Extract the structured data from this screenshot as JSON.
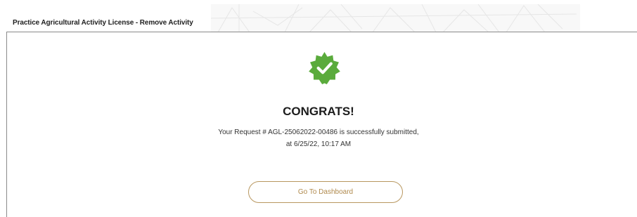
{
  "header": {
    "title": "Practice Agricultural Activity License - Remove Activity"
  },
  "success": {
    "icon": "check-badge-icon",
    "heading": "CONGRATS!",
    "message_line1": "Your Request # AGL-25062022-00486 is successfully submitted,",
    "message_line2": "at 6/25/22, 10:17 AM"
  },
  "actions": {
    "dashboard_label": "Go To Dashboard"
  },
  "colors": {
    "success_green": "#5aab3c",
    "accent_gold": "#b8975f",
    "rule_gray": "#8a8a8a"
  }
}
